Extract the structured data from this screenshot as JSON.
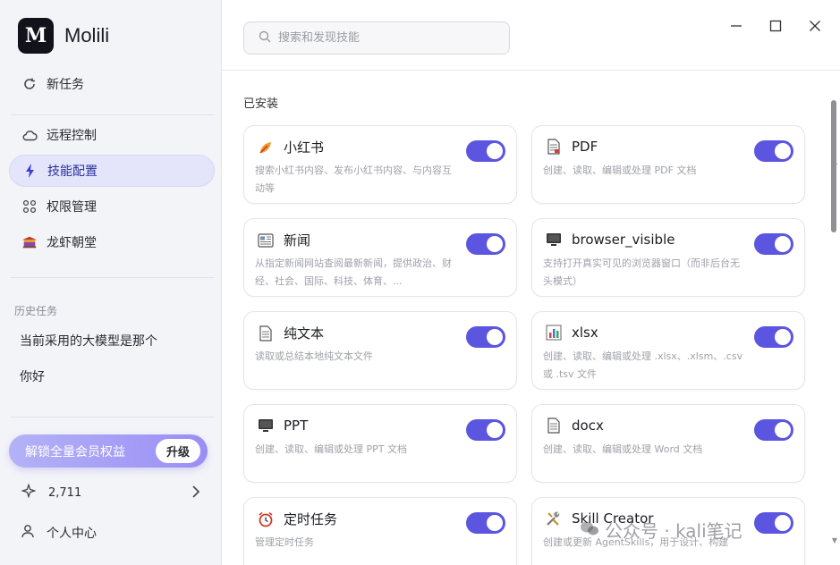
{
  "app": {
    "logo_letter": "M",
    "name": "Molili"
  },
  "sidebar": {
    "new_task": "新任务",
    "items": [
      {
        "label": "远程控制",
        "icon": "cloud-icon"
      },
      {
        "label": "技能配置",
        "icon": "lightning-icon",
        "active": true
      },
      {
        "label": "权限管理",
        "icon": "grid-dots-icon"
      },
      {
        "label": "龙虾朝堂",
        "icon": "palace-icon"
      }
    ],
    "history_label": "历史任务",
    "history": [
      "当前采用的大模型是那个",
      "你好"
    ],
    "upgrade_text": "解锁全量会员权益",
    "upgrade_button": "升级",
    "credits": "2,711",
    "profile": "个人中心"
  },
  "search": {
    "placeholder": "搜索和发现技能"
  },
  "main": {
    "installed_label": "已安装",
    "skills": [
      {
        "title": "小红书",
        "desc": "搜索小红书内容、发布小红书内容、与内容互动等",
        "icon": "xiaohongshu-icon",
        "enabled": true
      },
      {
        "title": "PDF",
        "desc": "创建、读取、编辑或处理 PDF 文档",
        "icon": "pdf-doc-icon",
        "enabled": true
      },
      {
        "title": "新闻",
        "desc": "从指定新闻网站查阅最新新闻，提供政治、财经、社会、国际、科技、体育、...",
        "icon": "newspaper-icon",
        "enabled": true
      },
      {
        "title": "browser_visible",
        "desc": "支持打开真实可见的浏览器窗口（而非后台无头模式）",
        "icon": "monitor-icon",
        "enabled": true
      },
      {
        "title": "纯文本",
        "desc": "读取或总结本地纯文本文件",
        "icon": "text-doc-icon",
        "enabled": true
      },
      {
        "title": "xlsx",
        "desc": "创建、读取、编辑或处理 .xlsx、.xlsm、.csv 或 .tsv 文件",
        "icon": "bar-chart-icon",
        "enabled": true
      },
      {
        "title": "PPT",
        "desc": "创建、读取、编辑或处理 PPT 文档",
        "icon": "monitor-icon",
        "enabled": true
      },
      {
        "title": "docx",
        "desc": "创建、读取、编辑或处理 Word 文档",
        "icon": "word-doc-icon",
        "enabled": true
      },
      {
        "title": "定时任务",
        "desc": "管理定时任务",
        "icon": "alarm-clock-icon",
        "enabled": true
      },
      {
        "title": "Skill Creator",
        "desc": "创建或更新 AgentSkills，用于设计、构建",
        "icon": "tools-icon",
        "enabled": true
      }
    ]
  },
  "watermark": "公众号 · kali笔记"
}
